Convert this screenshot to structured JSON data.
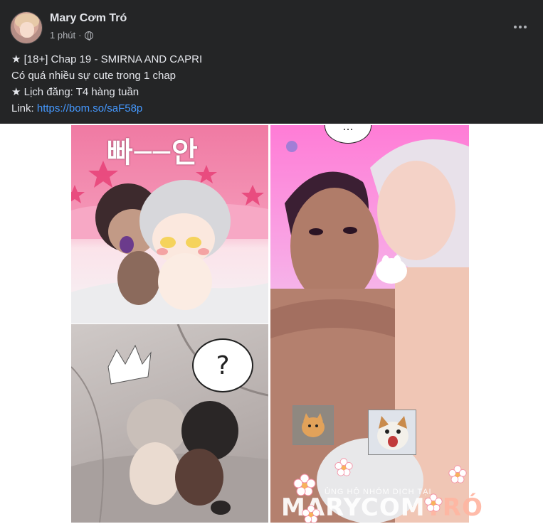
{
  "post": {
    "author": "Mary Cơm Tró",
    "time": "1 phút",
    "separator": "·",
    "privacy_icon": "globe-icon",
    "more_icon": "more-horizontal-icon"
  },
  "content": {
    "line1": "★ [18+] Chap 19 - SMIRNA AND CAPRI",
    "line2": "Có quá nhiều sự cute trong 1 chap",
    "line3": "★ Lịch đăng: T4 hàng tuần",
    "link_label": "Link:",
    "link_url": "https://bom.so/saF58p"
  },
  "media": {
    "panel1_sfx": "빠──안",
    "panel2_bubble": "?",
    "panel3_bubble": "...",
    "watermark_sub": "ỦNG HỘ NHÓM DỊCH TẠI",
    "watermark_main": "MARYCOM",
    "watermark_accent": "TRÓ"
  },
  "colors": {
    "background": "#242526",
    "text_primary": "#e4e6eb",
    "text_secondary": "#b0b3b8",
    "link": "#4599ff"
  }
}
